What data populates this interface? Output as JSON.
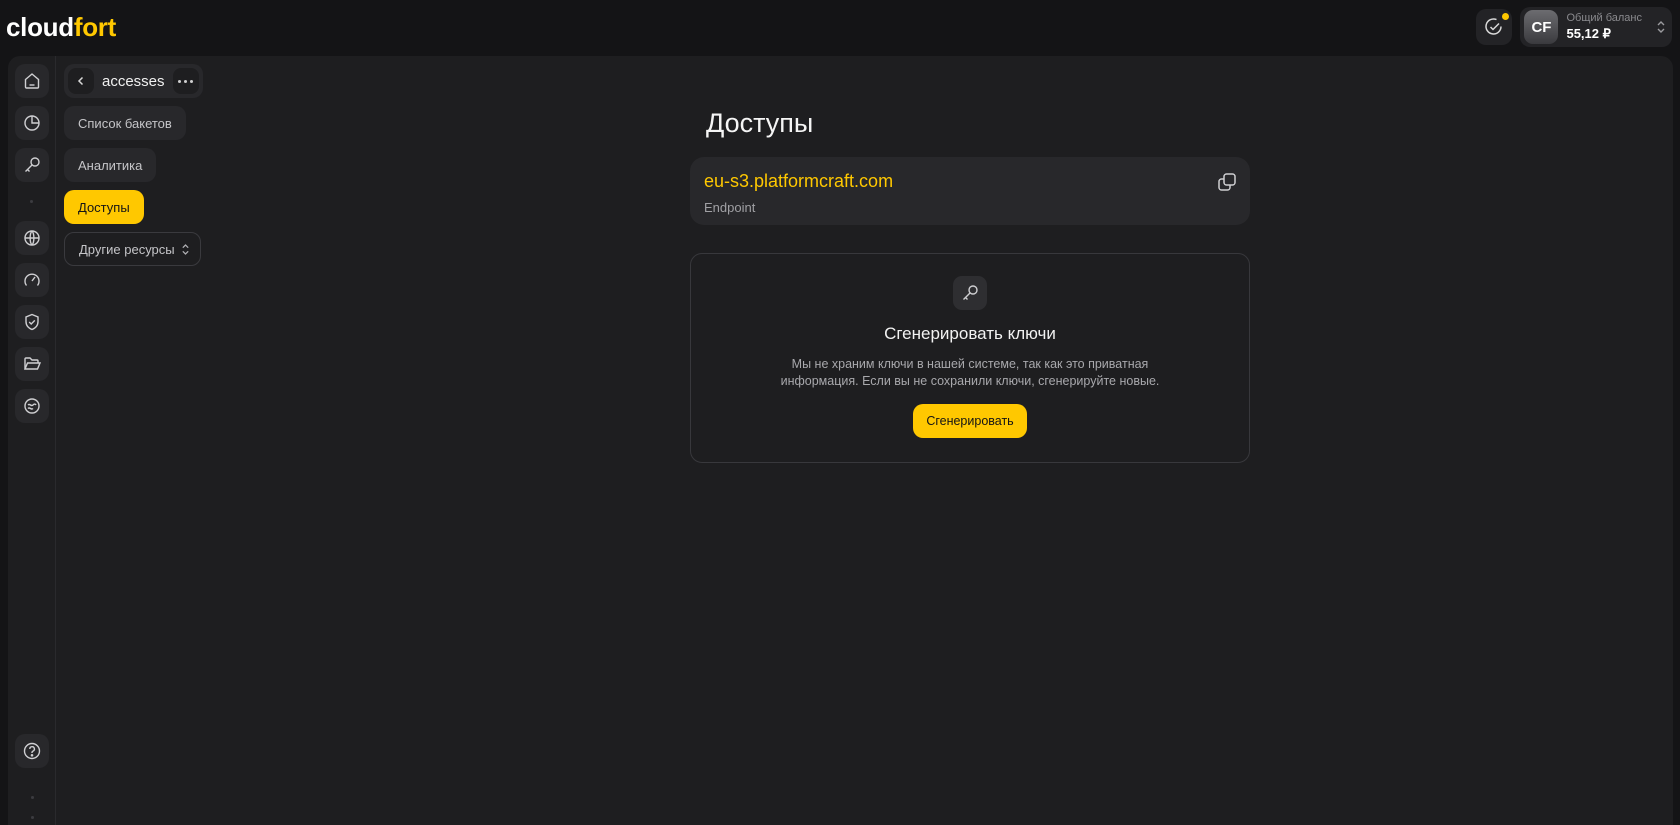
{
  "brand": {
    "logo_part1": "cloud",
    "logo_part2": "fort",
    "accent": "#ffc800"
  },
  "header": {
    "status_icon": "check-circle-icon",
    "account": {
      "avatar_initials": "CF",
      "balance_label": "Общий баланс",
      "balance_value": "55,12 ₽"
    }
  },
  "rail": {
    "items": [
      {
        "icon": "home-icon"
      },
      {
        "icon": "pie-chart-icon"
      },
      {
        "icon": "key-icon"
      },
      {
        "icon": "globe-icon"
      },
      {
        "icon": "gauge-icon"
      },
      {
        "icon": "shield-check-icon"
      },
      {
        "icon": "folder-open-icon"
      },
      {
        "icon": "storage-icon"
      }
    ],
    "help_icon": "help-icon"
  },
  "subnav": {
    "title": "accesses",
    "items": [
      {
        "label": "Список бакетов",
        "active": false
      },
      {
        "label": "Аналитика",
        "active": false
      },
      {
        "label": "Доступы",
        "active": true
      }
    ],
    "more_resources": "Другие ресурсы"
  },
  "main": {
    "title": "Доступы",
    "endpoint": {
      "url": "eu-s3.platformcraft.com",
      "label": "Endpoint"
    },
    "keys": {
      "title": "Сгенерировать ключи",
      "desc_line1": "Мы не храним ключи в нашей системе, так как это приватная",
      "desc_line2": "информация. Если вы не сохранили ключи, сгенерируйте новые.",
      "button": "Сгенерировать"
    }
  }
}
